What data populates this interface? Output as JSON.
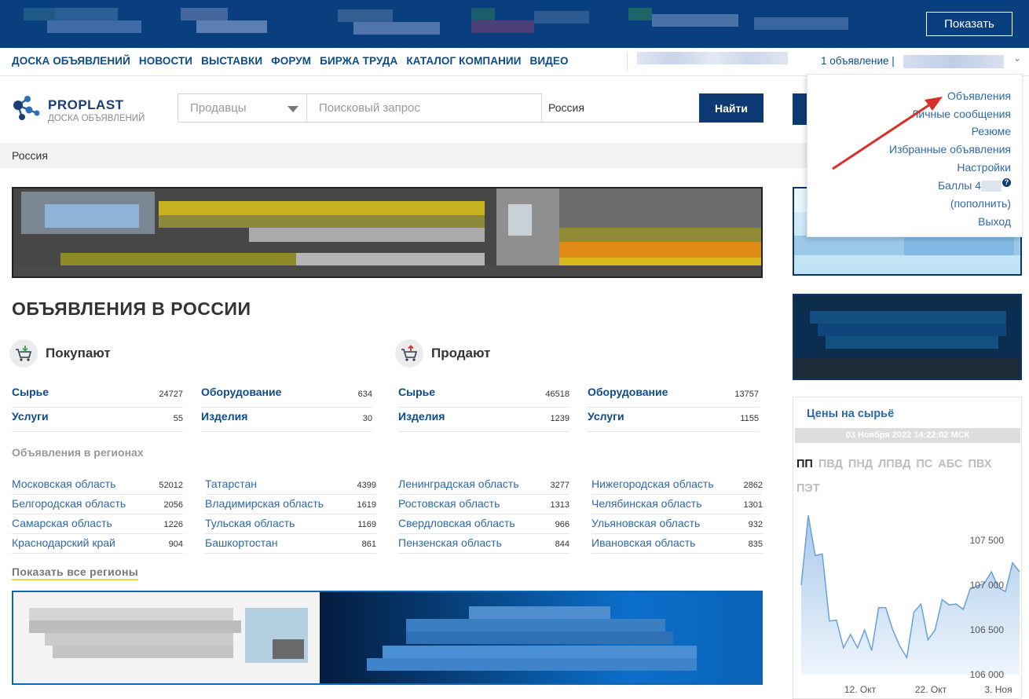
{
  "top_banner": {
    "show_button": "Показать"
  },
  "nav": {
    "links": [
      "ДОСКА ОБЪЯВЛЕНИЙ",
      "НОВОСТИ",
      "ВЫСТАВКИ",
      "ФОРУМ",
      "БИРЖА ТРУДА",
      "КАТАЛОГ КОМПАНИИ",
      "ВИДЕО"
    ],
    "user_link": "1 объявление | "
  },
  "logo": {
    "title": "PROPLAST",
    "subtitle": "ДОСКА ОБЪЯВЛЕНИЙ"
  },
  "search": {
    "category": "Продавцы",
    "query_placeholder": "Поисковый запрос",
    "location": "Россия",
    "button": "Найти"
  },
  "breadcrumb": "Россия",
  "heading": "ОБЪЯВЛЕНИЯ В РОССИИ",
  "buy": {
    "title": "Покупают",
    "categories": [
      {
        "name": "Сырье",
        "count": "24727"
      },
      {
        "name": "Оборудование",
        "count": "634"
      },
      {
        "name": "Услуги",
        "count": "55"
      },
      {
        "name": "Изделия",
        "count": "30"
      }
    ]
  },
  "sell": {
    "title": "Продают",
    "categories": [
      {
        "name": "Сырье",
        "count": "46518"
      },
      {
        "name": "Оборудование",
        "count": "13757"
      },
      {
        "name": "Изделия",
        "count": "1239"
      },
      {
        "name": "Услуги",
        "count": "1155"
      }
    ]
  },
  "regions": {
    "title": "Объявления в регионах",
    "items": [
      {
        "name": "Московская область",
        "count": "52012"
      },
      {
        "name": "Татарстан",
        "count": "4399"
      },
      {
        "name": "Ленинградская область",
        "count": "3277"
      },
      {
        "name": "Нижегородская область",
        "count": "2862"
      },
      {
        "name": "Белгородская область",
        "count": "2056"
      },
      {
        "name": "Владимирская область",
        "count": "1619"
      },
      {
        "name": "Ростовская область",
        "count": "1313"
      },
      {
        "name": "Челябинская область",
        "count": "1301"
      },
      {
        "name": "Самарская область",
        "count": "1226"
      },
      {
        "name": "Тульская область",
        "count": "1169"
      },
      {
        "name": "Свердловская область",
        "count": "966"
      },
      {
        "name": "Ульяновская область",
        "count": "932"
      },
      {
        "name": "Краснодарский край",
        "count": "904"
      },
      {
        "name": "Башкортостан",
        "count": "861"
      },
      {
        "name": "Пензенская область",
        "count": "844"
      },
      {
        "name": "Ивановская область",
        "count": "835"
      }
    ],
    "show_all": "Показать все регионы"
  },
  "prices": {
    "title": "Цены на сырьё",
    "date": "03 Ноября 2022 14:22:02 МСК",
    "tabs": [
      "ПП",
      "ПВД",
      "ПНД",
      "ЛПВД",
      "ПС",
      "АБС",
      "ПВХ",
      "ПЭТ"
    ],
    "active_tab": "ПП"
  },
  "user_menu": {
    "items": [
      "Объявления",
      "Личные сообщения",
      "Резюме",
      "Избранные объявления",
      "Настройки",
      "Баллы 4",
      "(пополнить)",
      "Выход"
    ]
  },
  "chart_data": {
    "type": "area",
    "x": [
      "12. Окт",
      "22. Окт",
      "3. Ноя"
    ],
    "y_ticks": [
      "107 500",
      "107 000",
      "106 500",
      "106 000"
    ],
    "ylim": [
      106000,
      107800
    ],
    "values": [
      107000,
      107780,
      107330,
      107350,
      106600,
      106610,
      106300,
      106450,
      106300,
      106500,
      106270,
      106750,
      106750,
      106500,
      106320,
      106190,
      106700,
      106790,
      106390,
      106500,
      106840,
      106780,
      106790,
      106730,
      106960,
      106990,
      107020,
      107150,
      106970,
      106930,
      107250,
      107150
    ],
    "grid": false
  },
  "colors": {
    "brand": "#0d3a73",
    "link": "#2f68a8",
    "nav": "#0d4b8a"
  }
}
